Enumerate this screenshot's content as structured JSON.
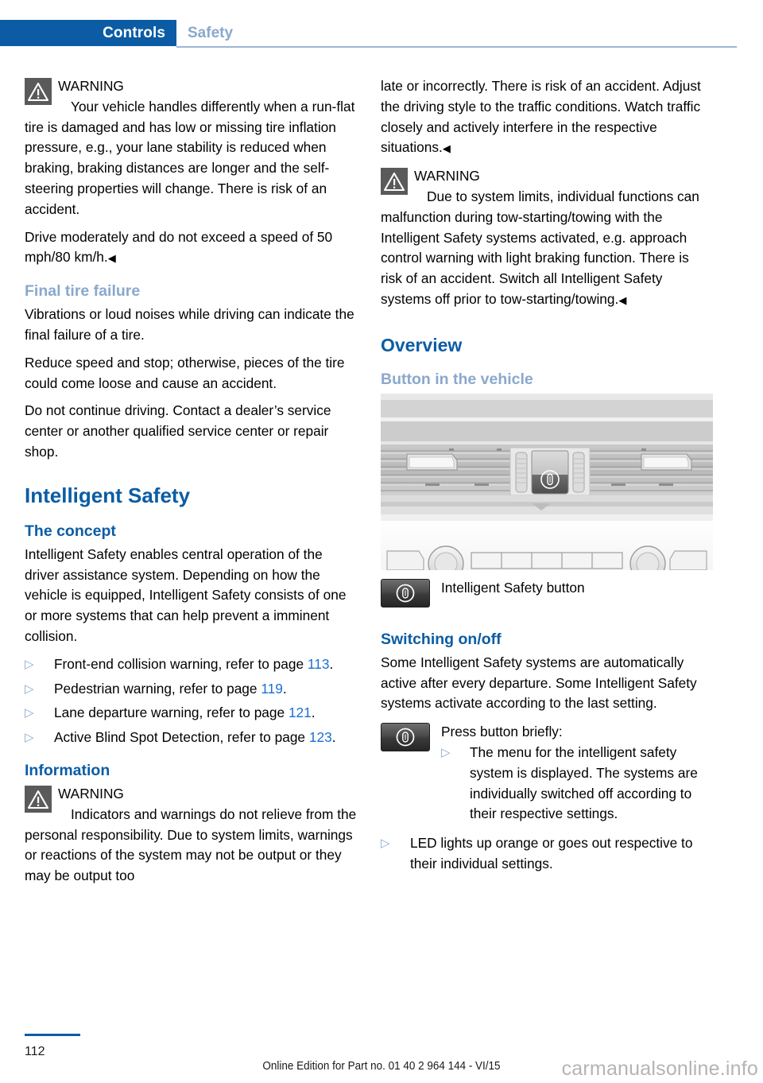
{
  "header": {
    "active_tab": "Controls",
    "inactive_tab": "Safety"
  },
  "left_column": {
    "warning1": {
      "icon": "warning-triangle-icon",
      "title": "WARNING",
      "body": "Your vehicle handles differently when a run-flat tire is damaged and has low or missing tire inflation pressure, e.g., your lane stability is reduced when braking, braking distances are longer and the self-steering properties will change. There is risk of an accident.",
      "continuation": "Drive moderately and do not exceed a speed of 50 mph/80 km/h.",
      "endmark": "◀"
    },
    "final_tire_failure": {
      "heading": "Final tire failure",
      "p1": "Vibrations or loud noises while driving can indicate the final failure of a tire.",
      "p2": "Reduce speed and stop; otherwise, pieces of the tire could come loose and cause an accident.",
      "p3": "Do not continue driving. Contact a dealer’s service center or another qualified service center or repair shop."
    },
    "intelligent_safety": {
      "title": "Intelligent Safety",
      "concept_heading": "The concept",
      "concept_body": "Intelligent Safety enables central operation of the driver assistance system. Depending on how the vehicle is equipped, Intelligent Safety consists of one or more systems that can help prevent a imminent collision.",
      "bullets": [
        {
          "marker": "▷",
          "text_before": "Front-end collision warning, refer to page ",
          "page_ref": "113",
          "text_after": "."
        },
        {
          "marker": "▷",
          "text_before": "Pedestrian warning, refer to page ",
          "page_ref": "119",
          "text_after": "."
        },
        {
          "marker": "▷",
          "text_before": "Lane departure warning, refer to page ",
          "page_ref": "121",
          "text_after": "."
        },
        {
          "marker": "▷",
          "text_before": "Active Blind Spot Detection, refer to page ",
          "page_ref": "123",
          "text_after": "."
        }
      ]
    },
    "information": {
      "heading": "Information",
      "warning": {
        "icon": "warning-triangle-icon",
        "title": "WARNING",
        "body": "Indicators and warnings do not relieve from the personal responsibility. Due to system limits, warnings or reactions of the system may not be output or they may be output too"
      }
    }
  },
  "right_column": {
    "continued_text": "late or incorrectly. There is risk of an accident. Adjust the driving style to the traffic conditions. Watch traffic closely and actively interfere in the respective situations.",
    "continued_endmark": "◀",
    "warning2": {
      "icon": "warning-triangle-icon",
      "title": "WARNING",
      "body": "Due to system limits, individual functions can malfunction during tow-starting/towing with the Intelligent Safety systems activated, e.g. approach control warning with light braking function. There is risk of an accident. Switch all Intelligent Safety systems off prior to tow-starting/towing.",
      "endmark": "◀"
    },
    "overview_heading": "Overview",
    "button_in_vehicle_heading": "Button in the vehicle",
    "figure": {
      "alt_name": "dashboard-center-console-illustration"
    },
    "figure_caption": {
      "icon": "intelligent-safety-button-icon",
      "text": "Intelligent Safety button"
    },
    "switching_heading": "Switching on/off",
    "switching_body": "Some Intelligent Safety systems are automatically active after every departure. Some Intelligent Safety systems activate according to the last setting.",
    "press_button": {
      "icon": "intelligent-safety-button-icon",
      "label": "Press button briefly:",
      "nested_bullets": [
        {
          "marker": "▷",
          "text": "The menu for the intelligent safety system is displayed. The systems are individually switched off according to their respective settings."
        }
      ]
    },
    "led_bullet": {
      "marker": "▷",
      "text": "LED lights up orange or goes out respective to their individual settings."
    }
  },
  "footer": {
    "page_number": "112",
    "edition_note": "Online Edition for Part no. 01 40 2 964 144 - VI/15",
    "watermark": "carmanualsonline.info"
  },
  "colors": {
    "brand_blue": "#0b5ca4",
    "light_blue": "#8aa8cd",
    "link_blue": "#1a6fd4",
    "warn_gray": "#5a5a5a"
  }
}
